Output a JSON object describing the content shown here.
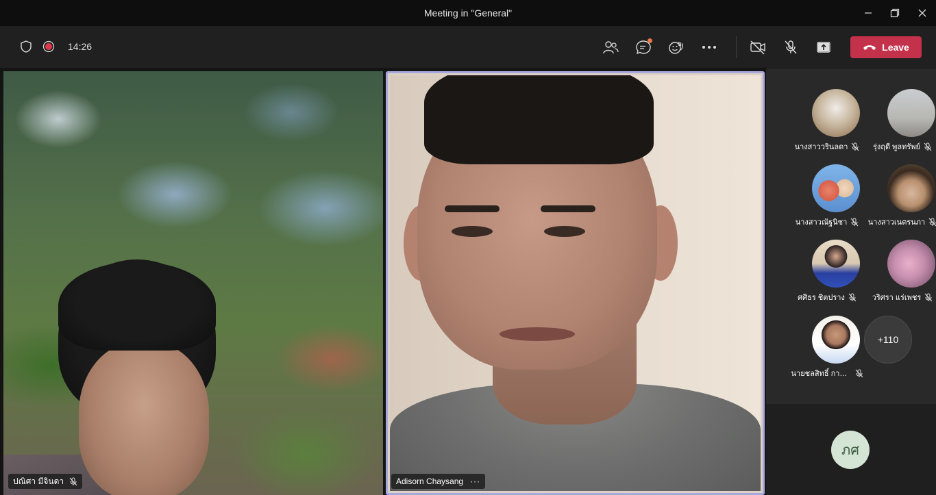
{
  "window": {
    "title": "Meeting in \"General\""
  },
  "toolbar": {
    "timer": "14:26",
    "leave_label": "Leave"
  },
  "stage": {
    "left_name": "ปณิศา มีจินดา",
    "center_name": "Adisorn Chaysang",
    "center_more": "···"
  },
  "participants": [
    {
      "name": "นางสาววรินลดา"
    },
    {
      "name": "รุ่งฤดี พูลทรัพย์"
    },
    {
      "name": "นางสาวณัฐนิชา"
    },
    {
      "name": "นางสาวเนตรนภา"
    },
    {
      "name": "ศศิธร ชิตปราง"
    },
    {
      "name": "วริศรา แร่เพชร"
    },
    {
      "name": "นายชลสิทธิ์ กาญจน"
    }
  ],
  "more_count": "+110",
  "self": {
    "initials": "ภศ"
  },
  "colors": {
    "leave": "#c4314b",
    "active_border": "#a6a7dc",
    "notif": "#e97548"
  }
}
